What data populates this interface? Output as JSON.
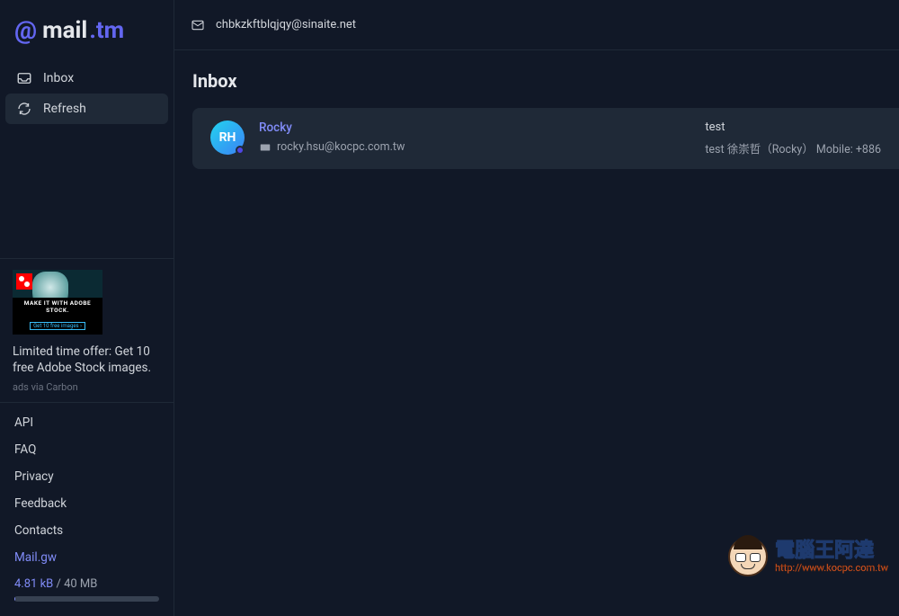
{
  "brand": {
    "prefix": "@",
    "mail": "mail",
    "dot_tm": ".tm"
  },
  "nav": {
    "inbox_label": "Inbox",
    "refresh_label": "Refresh"
  },
  "ad": {
    "headline1": "MAKE IT WITH ADOBE STOCK.",
    "headline2": "Get 10 free images ›",
    "text": "Limited time offer: Get 10 free Adobe Stock images.",
    "via": "ads via Carbon"
  },
  "footer_links": {
    "api": "API",
    "faq": "FAQ",
    "privacy": "Privacy",
    "feedback": "Feedback",
    "contacts": "Contacts",
    "mailgw": "Mail.gw"
  },
  "storage": {
    "used": "4.81 kB",
    "separator": "  / ",
    "total": "40 MB"
  },
  "header": {
    "email": "chbkzkftblqjqy@sinaite.net"
  },
  "page": {
    "title": "Inbox"
  },
  "message": {
    "avatar_initials": "RH",
    "sender_name": "Rocky",
    "sender_email": "rocky.hsu@kocpc.com.tw",
    "subject": "test",
    "preview": "test 徐崇哲（Rocky）  Mobile: +886"
  },
  "watermark": {
    "cn": "電腦王阿達",
    "url": "http://www.kocpc.com.tw"
  }
}
